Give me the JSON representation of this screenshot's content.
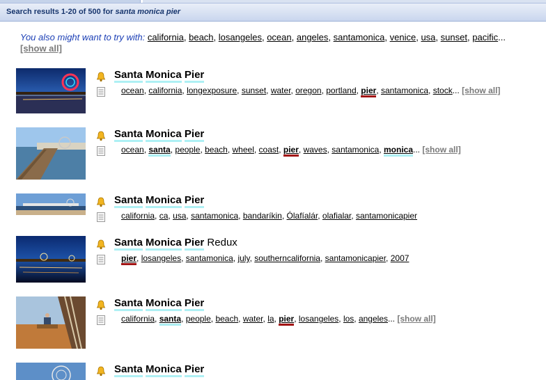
{
  "header": {
    "prefix": "Search results 1-20 of 500 for ",
    "query": "santa monica pier"
  },
  "suggestions": {
    "lead": "You also might want to try with:",
    "tags": [
      "california",
      "beach",
      "losangeles",
      "ocean",
      "angeles",
      "santamonica",
      "venice",
      "usa",
      "sunset",
      "pacific"
    ],
    "ellipsis": "...",
    "show_all": "[show all]"
  },
  "results": [
    {
      "title_words": [
        "Santa",
        "Monica",
        "Pier"
      ],
      "title_suffix": "",
      "tags": [
        {
          "t": "ocean"
        },
        {
          "t": "california"
        },
        {
          "t": "longexposure"
        },
        {
          "t": "sunset"
        },
        {
          "t": "water"
        },
        {
          "t": "oregon"
        },
        {
          "t": "portland"
        },
        {
          "t": "pier",
          "hl": "red"
        },
        {
          "t": "santamonica"
        },
        {
          "t": "stock"
        }
      ],
      "more": "...",
      "show_all": "[show all]"
    },
    {
      "title_words": [
        "Santa",
        "Monica",
        "Pier"
      ],
      "title_suffix": "",
      "tags": [
        {
          "t": "ocean"
        },
        {
          "t": "santa",
          "hl": "cyan"
        },
        {
          "t": "people"
        },
        {
          "t": "beach"
        },
        {
          "t": "wheel"
        },
        {
          "t": "coast"
        },
        {
          "t": "pier",
          "hl": "red"
        },
        {
          "t": "waves"
        },
        {
          "t": "santamonica"
        },
        {
          "t": "monica",
          "hl": "cyan"
        }
      ],
      "more": "...",
      "show_all": "[show all]"
    },
    {
      "title_words": [
        "Santa",
        "Monica",
        "Pier"
      ],
      "title_suffix": "",
      "tags": [
        {
          "t": "california"
        },
        {
          "t": "ca"
        },
        {
          "t": "usa"
        },
        {
          "t": "santamonica"
        },
        {
          "t": "bandaríkin"
        },
        {
          "t": "Ólafíalár"
        },
        {
          "t": "olafialar"
        },
        {
          "t": "santamonicapier"
        }
      ],
      "more": "",
      "show_all": ""
    },
    {
      "title_words": [
        "Santa",
        "Monica",
        "Pier"
      ],
      "title_suffix": "Redux",
      "tags": [
        {
          "t": "pier",
          "hl": "red"
        },
        {
          "t": "losangeles"
        },
        {
          "t": "santamonica"
        },
        {
          "t": "july"
        },
        {
          "t": "southerncalifornia"
        },
        {
          "t": "santamonicapier"
        },
        {
          "t": "2007"
        }
      ],
      "more": "",
      "show_all": ""
    },
    {
      "title_words": [
        "Santa",
        "Monica",
        "Pier"
      ],
      "title_suffix": "",
      "tags": [
        {
          "t": "california"
        },
        {
          "t": "santa",
          "hl": "cyan"
        },
        {
          "t": "people"
        },
        {
          "t": "beach"
        },
        {
          "t": "water"
        },
        {
          "t": "la"
        },
        {
          "t": "pier",
          "hl": "red"
        },
        {
          "t": "losangeles"
        },
        {
          "t": "los"
        },
        {
          "t": "angeles"
        }
      ],
      "more": "...",
      "show_all": "[show all]"
    },
    {
      "title_words": [
        "Santa",
        "Monica",
        "Pier"
      ],
      "title_suffix": "",
      "tags": [],
      "more": "",
      "show_all": ""
    }
  ],
  "icons": {
    "subscribe": "bell-icon",
    "tags": "document-icon"
  },
  "colors": {
    "header_text": "#17356d",
    "suggest_lead": "#1a3eb5",
    "cyan_highlight": "#aef0f4",
    "red_highlight": "#a21414",
    "show_all": "#7a7a7a"
  }
}
